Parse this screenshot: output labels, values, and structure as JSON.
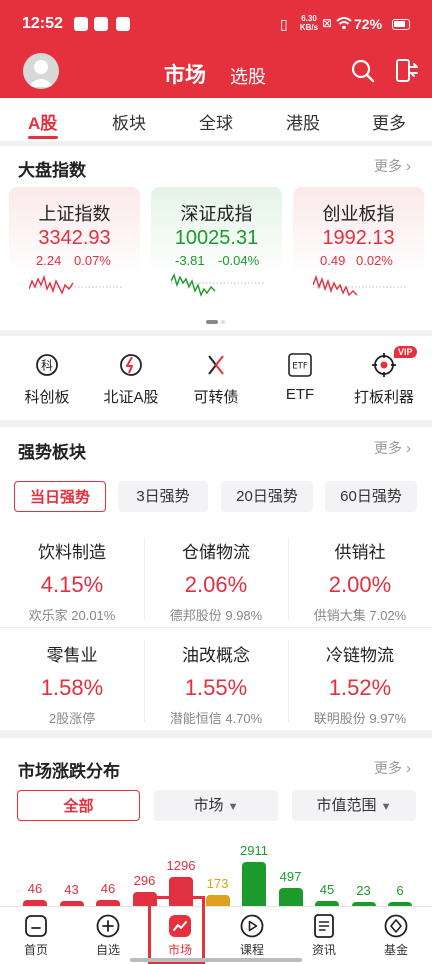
{
  "status_bar": {
    "time": "12:52",
    "net_speed": "6.30 KB/s",
    "battery": "72%"
  },
  "header": {
    "title": "市场",
    "watchlist": "选股"
  },
  "top_tabs": [
    "A股",
    "板块",
    "全球",
    "港股",
    "更多"
  ],
  "index_section": {
    "title": "大盘指数",
    "more": "更多",
    "cards": [
      {
        "name": "上证指数",
        "value": "3342.93",
        "change": "2.24",
        "pct": "0.07%",
        "trend": "up"
      },
      {
        "name": "深证成指",
        "value": "10025.31",
        "change": "-3.81",
        "pct": "-0.04%",
        "trend": "down"
      },
      {
        "name": "创业板指",
        "value": "1992.13",
        "change": "0.49",
        "pct": "0.02%",
        "trend": "up"
      }
    ]
  },
  "shortcuts": {
    "items": [
      {
        "label": "科创板",
        "icon": "star-board-icon"
      },
      {
        "label": "北证A股",
        "icon": "beijing-exchange-icon"
      },
      {
        "label": "可转债",
        "icon": "convertible-bond-icon"
      },
      {
        "label": "ETF",
        "icon": "etf-icon"
      },
      {
        "label": "打板利器",
        "icon": "target-icon"
      }
    ],
    "vip_badge": "VIP"
  },
  "strong_sectors": {
    "title": "强势板块",
    "more": "更多",
    "filters": [
      "当日强势",
      "3日强势",
      "20日强势",
      "60日强势"
    ],
    "items": [
      {
        "name": "饮料制造",
        "pct": "4.15%",
        "lead": "欢乐家 20.01%"
      },
      {
        "name": "仓储物流",
        "pct": "2.06%",
        "lead": "德邦股份 9.98%"
      },
      {
        "name": "供销社",
        "pct": "2.00%",
        "lead": "供销大集 7.02%"
      },
      {
        "name": "零售业",
        "pct": "1.58%",
        "lead": "2股涨停"
      },
      {
        "name": "油改概念",
        "pct": "1.55%",
        "lead": "潜能恒信 4.70%"
      },
      {
        "name": "冷链物流",
        "pct": "1.52%",
        "lead": "联明股份 9.97%"
      }
    ]
  },
  "distribution": {
    "title": "市场涨跌分布",
    "more": "更多",
    "filters": [
      "全部",
      "市场",
      "市值范围"
    ],
    "bars": [
      {
        "label": "46",
        "color": "red"
      },
      {
        "label": "43",
        "color": "red"
      },
      {
        "label": "46",
        "color": "red"
      },
      {
        "label": "296",
        "color": "red"
      },
      {
        "label": "1296",
        "color": "red"
      },
      {
        "label": "173",
        "color": "orange"
      },
      {
        "label": "2911",
        "color": "green"
      },
      {
        "label": "497",
        "color": "green"
      },
      {
        "label": "45",
        "color": "green"
      },
      {
        "label": "23",
        "color": "green"
      },
      {
        "label": "6",
        "color": "green"
      }
    ]
  },
  "bottom_nav": [
    "首页",
    "自选",
    "市场",
    "课程",
    "资讯",
    "基金"
  ],
  "colors": {
    "brand_red": "#e5303e",
    "up": "#e1303f",
    "down": "#1c9a2c"
  }
}
